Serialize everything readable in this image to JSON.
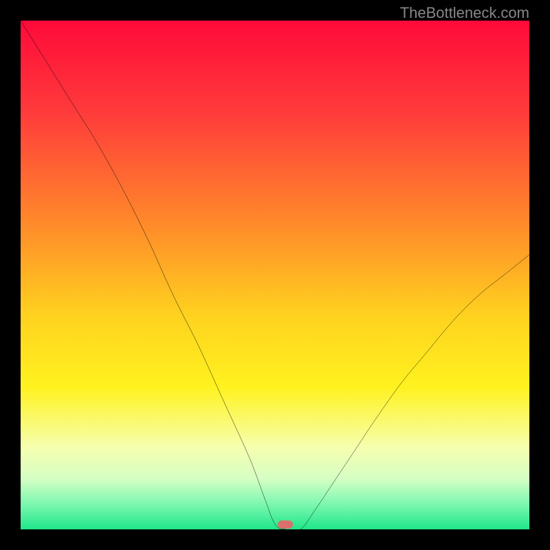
{
  "watermark": "TheBottleneck.com",
  "marker": {
    "x_pct": 52.0,
    "y_pct": 99.0
  },
  "chart_data": {
    "type": "line",
    "title": "",
    "xlabel": "",
    "ylabel": "",
    "xlim": [
      0,
      100
    ],
    "ylim": [
      0,
      100
    ],
    "series": [
      {
        "name": "bottleneck-curve",
        "x": [
          0,
          5,
          10,
          15,
          20,
          25,
          30,
          35,
          40,
          45,
          48,
          50,
          52,
          55,
          58,
          62,
          66,
          70,
          75,
          80,
          85,
          90,
          95,
          100
        ],
        "y": [
          100,
          92,
          84,
          76,
          67,
          57,
          46,
          36,
          25,
          14,
          6,
          1,
          0,
          0,
          4,
          10,
          16,
          22,
          29,
          35,
          41,
          46,
          50,
          54
        ]
      }
    ],
    "gradient_stops": [
      {
        "pct": 0,
        "color": "#ff0a3a"
      },
      {
        "pct": 18,
        "color": "#ff3b3b"
      },
      {
        "pct": 40,
        "color": "#ff8a2a"
      },
      {
        "pct": 58,
        "color": "#ffd21f"
      },
      {
        "pct": 72,
        "color": "#fff21f"
      },
      {
        "pct": 84,
        "color": "#f6ffb0"
      },
      {
        "pct": 90,
        "color": "#d6ffc4"
      },
      {
        "pct": 95,
        "color": "#7df7b0"
      },
      {
        "pct": 100,
        "color": "#1fe68a"
      }
    ]
  }
}
